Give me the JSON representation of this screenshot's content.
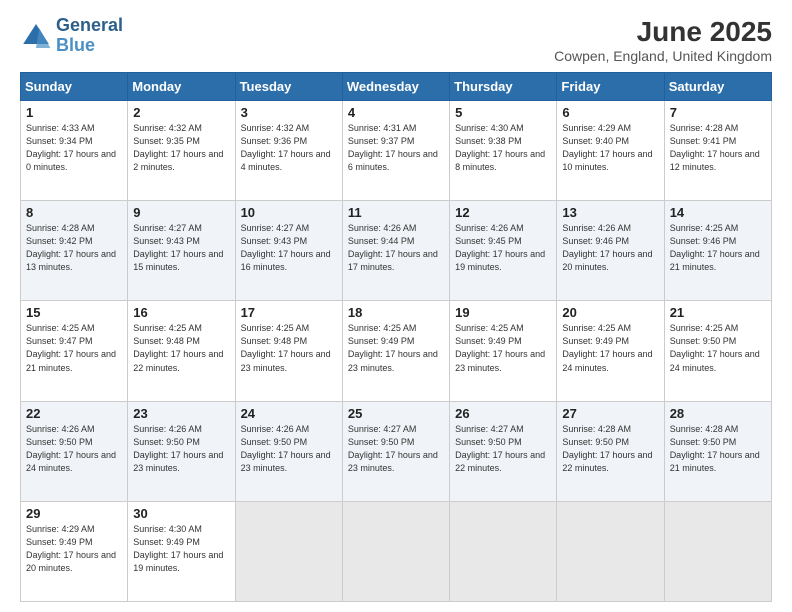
{
  "logo": {
    "line1": "General",
    "line2": "Blue"
  },
  "title": "June 2025",
  "subtitle": "Cowpen, England, United Kingdom",
  "days_header": [
    "Sunday",
    "Monday",
    "Tuesday",
    "Wednesday",
    "Thursday",
    "Friday",
    "Saturday"
  ],
  "weeks": [
    [
      {
        "day": "1",
        "sunrise": "4:33 AM",
        "sunset": "9:34 PM",
        "daylight": "17 hours and 0 minutes."
      },
      {
        "day": "2",
        "sunrise": "4:32 AM",
        "sunset": "9:35 PM",
        "daylight": "17 hours and 2 minutes."
      },
      {
        "day": "3",
        "sunrise": "4:32 AM",
        "sunset": "9:36 PM",
        "daylight": "17 hours and 4 minutes."
      },
      {
        "day": "4",
        "sunrise": "4:31 AM",
        "sunset": "9:37 PM",
        "daylight": "17 hours and 6 minutes."
      },
      {
        "day": "5",
        "sunrise": "4:30 AM",
        "sunset": "9:38 PM",
        "daylight": "17 hours and 8 minutes."
      },
      {
        "day": "6",
        "sunrise": "4:29 AM",
        "sunset": "9:40 PM",
        "daylight": "17 hours and 10 minutes."
      },
      {
        "day": "7",
        "sunrise": "4:28 AM",
        "sunset": "9:41 PM",
        "daylight": "17 hours and 12 minutes."
      }
    ],
    [
      {
        "day": "8",
        "sunrise": "4:28 AM",
        "sunset": "9:42 PM",
        "daylight": "17 hours and 13 minutes."
      },
      {
        "day": "9",
        "sunrise": "4:27 AM",
        "sunset": "9:43 PM",
        "daylight": "17 hours and 15 minutes."
      },
      {
        "day": "10",
        "sunrise": "4:27 AM",
        "sunset": "9:43 PM",
        "daylight": "17 hours and 16 minutes."
      },
      {
        "day": "11",
        "sunrise": "4:26 AM",
        "sunset": "9:44 PM",
        "daylight": "17 hours and 17 minutes."
      },
      {
        "day": "12",
        "sunrise": "4:26 AM",
        "sunset": "9:45 PM",
        "daylight": "17 hours and 19 minutes."
      },
      {
        "day": "13",
        "sunrise": "4:26 AM",
        "sunset": "9:46 PM",
        "daylight": "17 hours and 20 minutes."
      },
      {
        "day": "14",
        "sunrise": "4:25 AM",
        "sunset": "9:46 PM",
        "daylight": "17 hours and 21 minutes."
      }
    ],
    [
      {
        "day": "15",
        "sunrise": "4:25 AM",
        "sunset": "9:47 PM",
        "daylight": "17 hours and 21 minutes."
      },
      {
        "day": "16",
        "sunrise": "4:25 AM",
        "sunset": "9:48 PM",
        "daylight": "17 hours and 22 minutes."
      },
      {
        "day": "17",
        "sunrise": "4:25 AM",
        "sunset": "9:48 PM",
        "daylight": "17 hours and 23 minutes."
      },
      {
        "day": "18",
        "sunrise": "4:25 AM",
        "sunset": "9:49 PM",
        "daylight": "17 hours and 23 minutes."
      },
      {
        "day": "19",
        "sunrise": "4:25 AM",
        "sunset": "9:49 PM",
        "daylight": "17 hours and 23 minutes."
      },
      {
        "day": "20",
        "sunrise": "4:25 AM",
        "sunset": "9:49 PM",
        "daylight": "17 hours and 24 minutes."
      },
      {
        "day": "21",
        "sunrise": "4:25 AM",
        "sunset": "9:50 PM",
        "daylight": "17 hours and 24 minutes."
      }
    ],
    [
      {
        "day": "22",
        "sunrise": "4:26 AM",
        "sunset": "9:50 PM",
        "daylight": "17 hours and 24 minutes."
      },
      {
        "day": "23",
        "sunrise": "4:26 AM",
        "sunset": "9:50 PM",
        "daylight": "17 hours and 23 minutes."
      },
      {
        "day": "24",
        "sunrise": "4:26 AM",
        "sunset": "9:50 PM",
        "daylight": "17 hours and 23 minutes."
      },
      {
        "day": "25",
        "sunrise": "4:27 AM",
        "sunset": "9:50 PM",
        "daylight": "17 hours and 23 minutes."
      },
      {
        "day": "26",
        "sunrise": "4:27 AM",
        "sunset": "9:50 PM",
        "daylight": "17 hours and 22 minutes."
      },
      {
        "day": "27",
        "sunrise": "4:28 AM",
        "sunset": "9:50 PM",
        "daylight": "17 hours and 22 minutes."
      },
      {
        "day": "28",
        "sunrise": "4:28 AM",
        "sunset": "9:50 PM",
        "daylight": "17 hours and 21 minutes."
      }
    ],
    [
      {
        "day": "29",
        "sunrise": "4:29 AM",
        "sunset": "9:49 PM",
        "daylight": "17 hours and 20 minutes."
      },
      {
        "day": "30",
        "sunrise": "4:30 AM",
        "sunset": "9:49 PM",
        "daylight": "17 hours and 19 minutes."
      },
      null,
      null,
      null,
      null,
      null
    ]
  ]
}
